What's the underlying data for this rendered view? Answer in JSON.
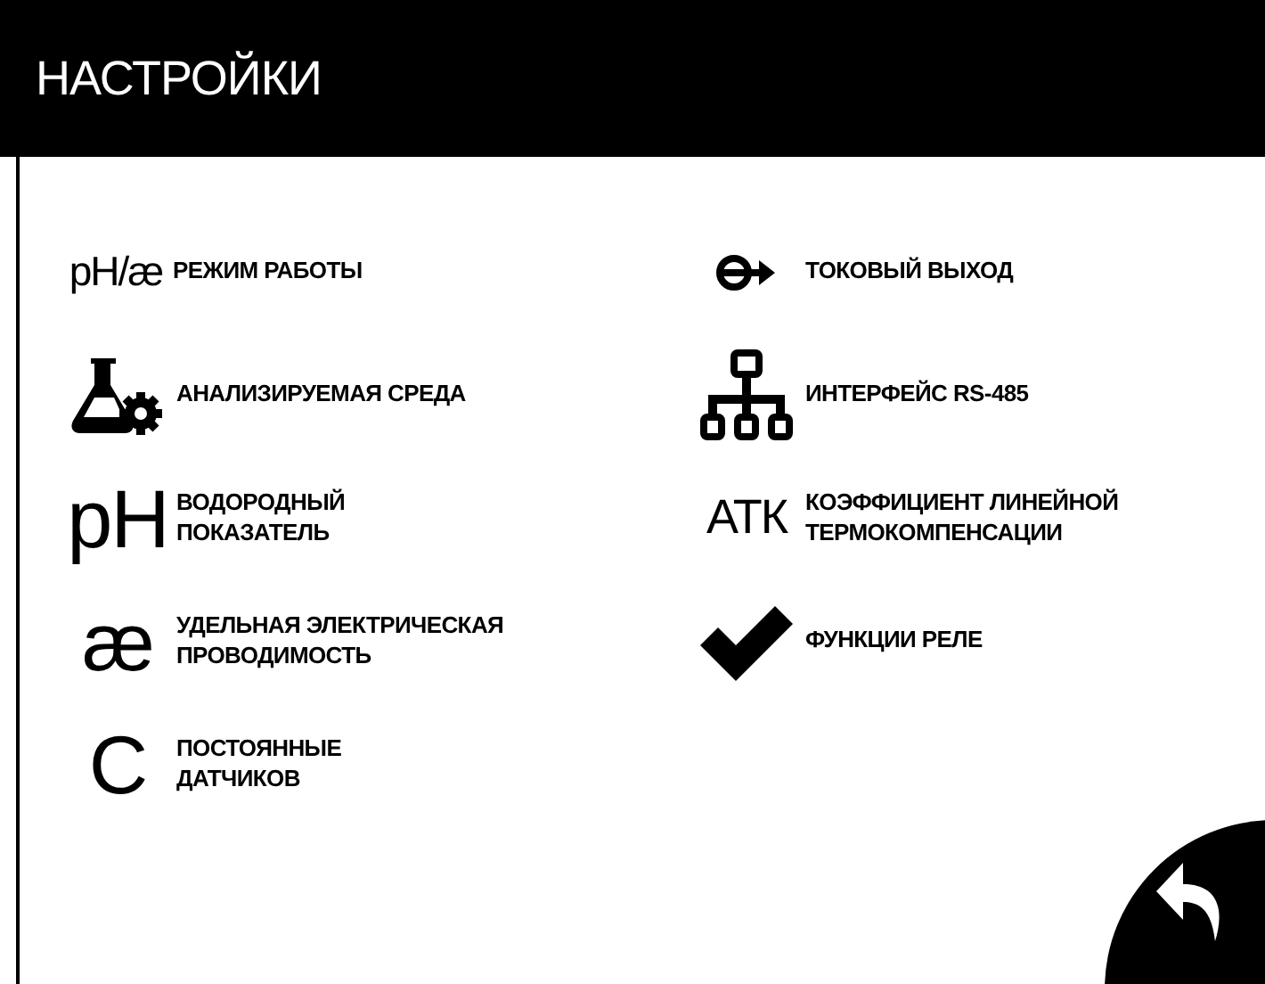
{
  "header": {
    "title": "НАСТРОЙКИ"
  },
  "columns": [
    {
      "items": [
        {
          "kind": "text",
          "icon_text": "pH/æ",
          "label": "РЕЖИМ РАБОТЫ"
        },
        {
          "kind": "flask",
          "label": "АНАЛИЗИРУЕМАЯ СРЕДА"
        },
        {
          "kind": "text",
          "icon_text": "pH",
          "label": "ВОДОРОДНЫЙ\nПОКАЗАТЕЛЬ"
        },
        {
          "kind": "text",
          "icon_text": "æ",
          "label": "УДЕЛЬНАЯ ЭЛЕКТРИЧЕСКАЯ\nПРОВОДИМОСТЬ"
        },
        {
          "kind": "text",
          "icon_text": "C",
          "label": "ПОСТОЯННЫЕ\nДАТЧИКОВ"
        }
      ]
    },
    {
      "items": [
        {
          "kind": "output",
          "label": "ТОКОВЫЙ ВЫХОД"
        },
        {
          "kind": "network",
          "label": "ИНТЕРФЕЙС RS-485"
        },
        {
          "kind": "text",
          "icon_text": "АТК",
          "label": "КОЭФФИЦИЕНТ ЛИНЕЙНОЙ\nТЕРМОКОМПЕНСАЦИИ"
        },
        {
          "kind": "check",
          "label": "ФУНКЦИИ РЕЛЕ"
        }
      ]
    }
  ]
}
